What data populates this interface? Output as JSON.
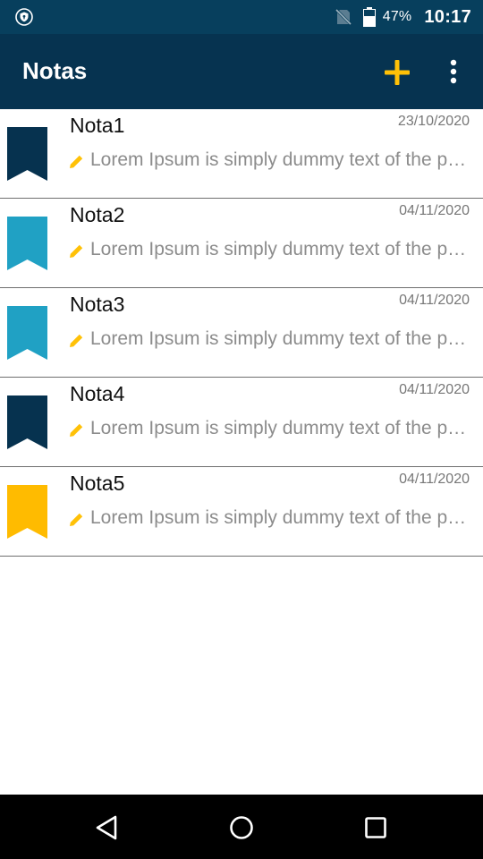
{
  "status_bar": {
    "battery": "47%",
    "time": "10:17",
    "icons": [
      "shield-icon",
      "no-sim-icon",
      "battery-icon"
    ]
  },
  "app_bar": {
    "title": "Notas",
    "actions": [
      "add-icon",
      "more-vert-icon"
    ],
    "accent_color": "#ffc107",
    "background_color": "#063350"
  },
  "notes": [
    {
      "title": "Nota1",
      "date": "23/10/2020",
      "preview": "Lorem Ipsum is simply dummy text of the printing and typesetting industry.",
      "color": "#06324f"
    },
    {
      "title": "Nota2",
      "date": "04/11/2020",
      "preview": "Lorem Ipsum is simply dummy text of the printing and typesetting industry.",
      "color": "#20a1c4"
    },
    {
      "title": "Nota3",
      "date": "04/11/2020",
      "preview": "Lorem Ipsum is simply dummy text of the printing and typesetting industry.",
      "color": "#20a1c4"
    },
    {
      "title": "Nota4",
      "date": "04/11/2020",
      "preview": "Lorem Ipsum is simply dummy text of the printing and typesetting industry.",
      "color": "#06324f"
    },
    {
      "title": "Nota5",
      "date": "04/11/2020",
      "preview": "Lorem Ipsum is simply dummy text of the printing and typesetting industry.",
      "color": "#ffbb00"
    }
  ],
  "nav_bar": {
    "buttons": [
      "back-icon",
      "home-icon",
      "recents-icon"
    ]
  }
}
